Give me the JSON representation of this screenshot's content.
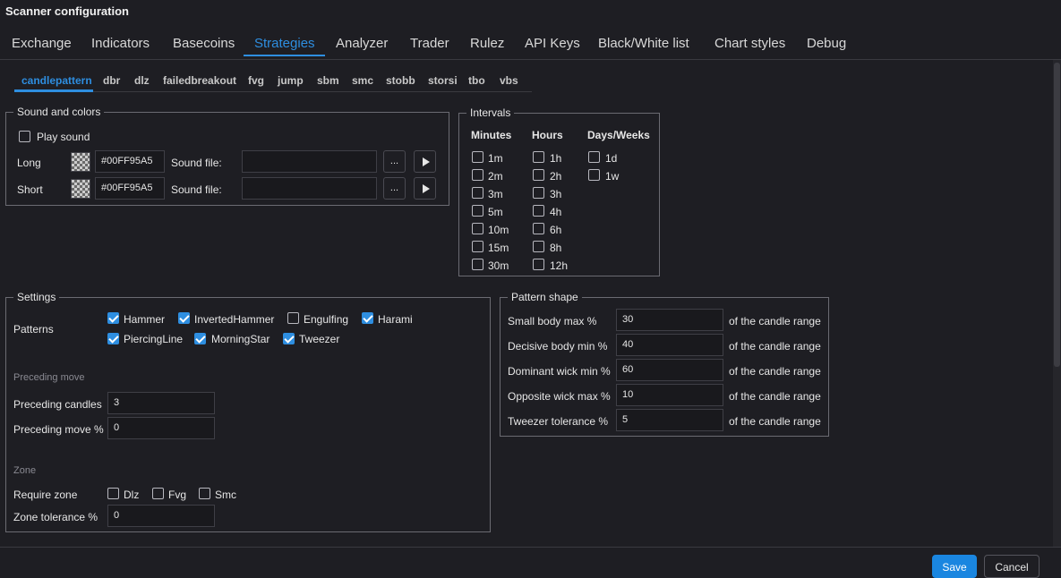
{
  "window": {
    "title": "Scanner configuration"
  },
  "main_tabs": [
    "Exchange",
    "Indicators",
    "Basecoins",
    "Strategies",
    "Analyzer",
    "Trader",
    "Rulez",
    "API Keys",
    "Black/White list",
    "Chart styles",
    "Debug"
  ],
  "main_tab_active": "Strategies",
  "sub_tabs": [
    "candlepattern",
    "dbr",
    "dlz",
    "failedbreakout",
    "fvg",
    "jump",
    "sbm",
    "smc",
    "stobb",
    "storsi",
    "tbo",
    "vbs"
  ],
  "sub_tab_active": "candlepattern",
  "sound": {
    "legend": "Sound and colors",
    "play_sound": "Play sound",
    "long_label": "Long",
    "long_color": "#00FF95A5",
    "short_label": "Short",
    "short_color": "#00FF95A5",
    "sound_file_label": "Sound file:",
    "browse_label": "..."
  },
  "intervals": {
    "legend": "Intervals",
    "minutes_header": "Minutes",
    "hours_header": "Hours",
    "days_header": "Days/Weeks",
    "minutes": [
      "1m",
      "2m",
      "3m",
      "5m",
      "10m",
      "15m",
      "30m"
    ],
    "hours": [
      "1h",
      "2h",
      "3h",
      "4h",
      "6h",
      "8h",
      "12h"
    ],
    "days": [
      "1d",
      "1w"
    ]
  },
  "settings": {
    "legend": "Settings",
    "patterns_label": "Patterns",
    "patterns": [
      {
        "label": "Hammer",
        "checked": true
      },
      {
        "label": "InvertedHammer",
        "checked": true
      },
      {
        "label": "Engulfing",
        "checked": false
      },
      {
        "label": "Harami",
        "checked": true
      },
      {
        "label": "PiercingLine",
        "checked": true
      },
      {
        "label": "MorningStar",
        "checked": true
      },
      {
        "label": "Tweezer",
        "checked": true
      }
    ],
    "preceding_section": "Preceding move",
    "preceding_candles_label": "Preceding candles",
    "preceding_candles_value": "3",
    "preceding_move_label": "Preceding move %",
    "preceding_move_value": "0",
    "zone_section": "Zone",
    "require_zone_label": "Require zone",
    "zone_options": [
      "Dlz",
      "Fvg",
      "Smc"
    ],
    "zone_tolerance_label": "Zone tolerance %",
    "zone_tolerance_value": "0"
  },
  "pattern_shape": {
    "legend": "Pattern shape",
    "suffix": "of the candle range",
    "rows": [
      {
        "label": "Small body max %",
        "value": "30"
      },
      {
        "label": "Decisive body min %",
        "value": "40"
      },
      {
        "label": "Dominant wick min %",
        "value": "60"
      },
      {
        "label": "Opposite wick max %",
        "value": "10"
      },
      {
        "label": "Tweezer tolerance %",
        "value": "5"
      }
    ]
  },
  "footer": {
    "save_label": "Save",
    "cancel_label": "Cancel"
  },
  "colors": {
    "accent": "#2e8ee0",
    "background": "#1e1e23"
  },
  "icons": {
    "play": "play-icon"
  }
}
